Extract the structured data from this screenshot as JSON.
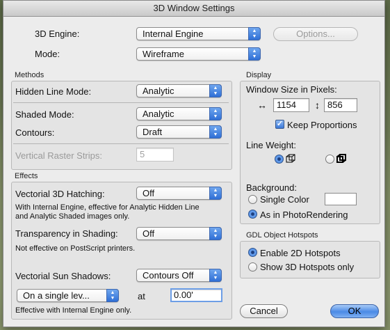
{
  "window": {
    "title": "3D Window Settings"
  },
  "engine": {
    "label": "3D Engine:",
    "value": "Internal Engine",
    "options_label": "Options...",
    "mode_label": "Mode:",
    "mode_value": "Wireframe"
  },
  "methods": {
    "title": "Methods",
    "hidden_line_label": "Hidden Line Mode:",
    "hidden_line_value": "Analytic",
    "shaded_label": "Shaded Mode:",
    "shaded_value": "Analytic",
    "contours_label": "Contours:",
    "contours_value": "Draft",
    "raster_label": "Vertical Raster Strips:",
    "raster_value": "5"
  },
  "effects": {
    "title": "Effects",
    "hatching_label": "Vectorial 3D Hatching:",
    "hatching_value": "Off",
    "hatching_note_1": "With Internal Engine, effective for Analytic Hidden Line",
    "hatching_note_2": "and Analytic Shaded images only.",
    "transparency_label": "Transparency in Shading:",
    "transparency_value": "Off",
    "transparency_note": "Not effective on PostScript printers.",
    "sun_label": "Vectorial Sun Shadows:",
    "sun_value": "Contours Off",
    "level_value": "On a single lev...",
    "at_label": "at",
    "at_value": "0.00'",
    "sun_note": "Effective with Internal Engine only."
  },
  "display": {
    "title": "Display",
    "window_size_label": "Window Size in Pixels:",
    "width_value": "1154",
    "height_value": "856",
    "width_icon": "↔",
    "height_icon": "↕",
    "keep_proportions_label": "Keep Proportions",
    "keep_proportions_checked": true,
    "line_weight_label": "Line Weight:",
    "line_weight_selected": "first",
    "background_label": "Background:",
    "single_color_label": "Single Color",
    "photorendering_label": "As in PhotoRendering",
    "background_selected": "photorendering"
  },
  "hotspots": {
    "title": "GDL Object Hotspots",
    "enable_2d_label": "Enable 2D Hotspots",
    "show_3d_label": "Show 3D Hotspots only",
    "selected": "2d"
  },
  "buttons": {
    "cancel": "Cancel",
    "ok": "OK"
  },
  "colors": {
    "accent": "#3b78d8",
    "dialog_bg": "#ececec"
  }
}
